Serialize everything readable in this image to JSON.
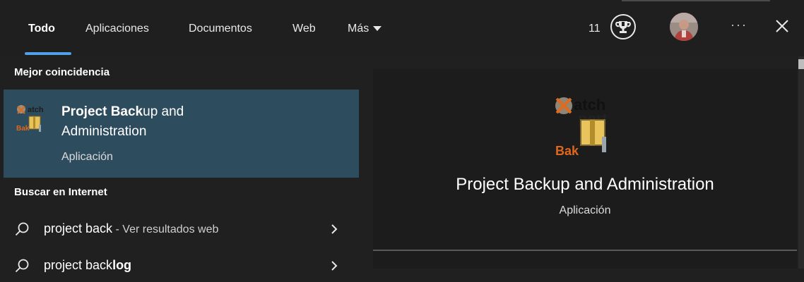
{
  "tabs": [
    {
      "label": "Todo",
      "active": true
    },
    {
      "label": "Aplicaciones"
    },
    {
      "label": "Documentos"
    },
    {
      "label": "Web"
    },
    {
      "label": "Más"
    }
  ],
  "header": {
    "rewards_points": "11",
    "more_label": "···",
    "trophy_icon": "trophy-icon",
    "close_icon": "close-icon"
  },
  "results": {
    "best_match_heading": "Mejor coincidencia",
    "best_match": {
      "title_bold": "Project Back",
      "title_rest": "up and",
      "title_line2": "Administration",
      "subtitle": "Aplicación",
      "icon_caption": "Bak"
    },
    "web_heading": "Buscar en Internet",
    "web_items": [
      {
        "query": "project back",
        "hint": " - Ver resultados web"
      },
      {
        "query_prefix": "project back",
        "query_bold": "log"
      }
    ]
  },
  "detail": {
    "title": "Project Backup and Administration",
    "subtitle": "Aplicación",
    "icon_caption": "Bak"
  },
  "colors": {
    "accent": "#4ea1e6",
    "selected_row": "#2d4c5e",
    "background": "#202020"
  }
}
